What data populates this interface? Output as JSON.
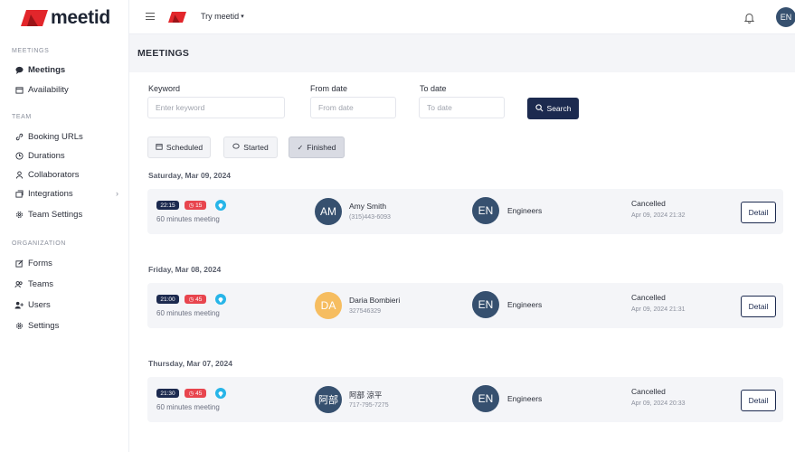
{
  "brand": {
    "name": "meetid",
    "color": "#e2262b",
    "accent": "#1c2a4f"
  },
  "topbar": {
    "workspace": "Try meetid",
    "avatar": "EN"
  },
  "sidebar": {
    "sections": [
      {
        "title": "MEETINGS",
        "items": [
          {
            "label": "Meetings",
            "icon": "chat-icon",
            "active": true
          },
          {
            "label": "Availability",
            "icon": "calendar-icon"
          }
        ]
      },
      {
        "title": "TEAM",
        "items": [
          {
            "label": "Booking URLs",
            "icon": "link-icon"
          },
          {
            "label": "Durations",
            "icon": "clock-icon"
          },
          {
            "label": "Collaborators",
            "icon": "user-icon"
          },
          {
            "label": "Integrations",
            "icon": "integrations-icon"
          },
          {
            "label": "Team Settings",
            "icon": "gear-icon"
          }
        ]
      },
      {
        "title": "ORGANIZATION",
        "items": [
          {
            "label": "Forms",
            "icon": "edit-icon"
          },
          {
            "label": "Teams",
            "icon": "users-icon"
          },
          {
            "label": "Users",
            "icon": "user-plus-icon"
          },
          {
            "label": "Settings",
            "icon": "gear-icon"
          }
        ]
      }
    ]
  },
  "page": {
    "title": "MEETINGS"
  },
  "filters": {
    "keyword_label": "Keyword",
    "keyword_placeholder": "Enter keyword",
    "from_label": "From date",
    "from_placeholder": "From date",
    "to_label": "To date",
    "to_placeholder": "To date",
    "search_label": "Search"
  },
  "tabs": [
    {
      "label": "Scheduled",
      "icon": "calendar-icon"
    },
    {
      "label": "Started",
      "icon": "chat-icon"
    },
    {
      "label": "Finished",
      "icon": "check-icon",
      "active": true
    }
  ],
  "groups": [
    {
      "date": "Saturday, Mar 09, 2024",
      "meeting": {
        "time": "22:15",
        "duration": "15",
        "desc": "60 minutes meeting",
        "guest_initials": "AM",
        "guest_color": "#36506f",
        "guest_name": "Amy Smith",
        "guest_phone": "(315)443-6093",
        "team_initials": "EN",
        "team_name": "Engineers",
        "status": "Cancelled",
        "status_time": "Apr 09, 2024 21:32",
        "detail": "Detail"
      }
    },
    {
      "date": "Friday, Mar 08, 2024",
      "meeting": {
        "time": "21:00",
        "duration": "45",
        "desc": "60 minutes meeting",
        "guest_initials": "DA",
        "guest_color": "#f6bd60",
        "guest_name": "Daria Bombieri",
        "guest_phone": "327546329",
        "team_initials": "EN",
        "team_name": "Engineers",
        "status": "Cancelled",
        "status_time": "Apr 09, 2024 21:31",
        "detail": "Detail"
      }
    },
    {
      "date": "Thursday, Mar 07, 2024",
      "meeting": {
        "time": "21:30",
        "duration": "45",
        "desc": "60 minutes meeting",
        "guest_initials": "阿部",
        "guest_color": "#36506f",
        "guest_name": "阿部 涼平",
        "guest_phone": "717-795-7275",
        "team_initials": "EN",
        "team_name": "Engineers",
        "status": "Cancelled",
        "status_time": "Apr 09, 2024 20:33",
        "detail": "Detail"
      }
    }
  ]
}
